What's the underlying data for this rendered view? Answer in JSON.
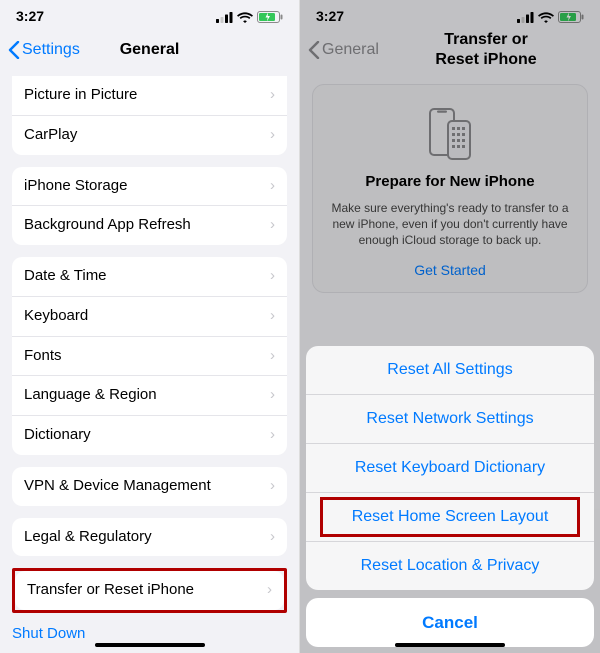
{
  "status": {
    "time": "3:27"
  },
  "left": {
    "back": "Settings",
    "title": "General",
    "group1": [
      "Picture in Picture",
      "CarPlay"
    ],
    "group2": [
      "iPhone Storage",
      "Background App Refresh"
    ],
    "group3": [
      "Date & Time",
      "Keyboard",
      "Fonts",
      "Language & Region",
      "Dictionary"
    ],
    "group4": [
      "VPN & Device Management"
    ],
    "group5": [
      "Legal & Regulatory"
    ],
    "group6": [
      "Transfer or Reset iPhone"
    ],
    "shutdown": "Shut Down"
  },
  "right": {
    "back": "General",
    "title": "Transfer or Reset iPhone",
    "card": {
      "heading": "Prepare for New iPhone",
      "body": "Make sure everything's ready to transfer to a new iPhone, even if you don't currently have enough iCloud storage to back up.",
      "action": "Get Started"
    },
    "sheet": {
      "items": [
        "Reset All Settings",
        "Reset Network Settings",
        "Reset Keyboard Dictionary",
        "Reset Home Screen Layout",
        "Reset Location & Privacy"
      ],
      "cancel": "Cancel"
    }
  }
}
